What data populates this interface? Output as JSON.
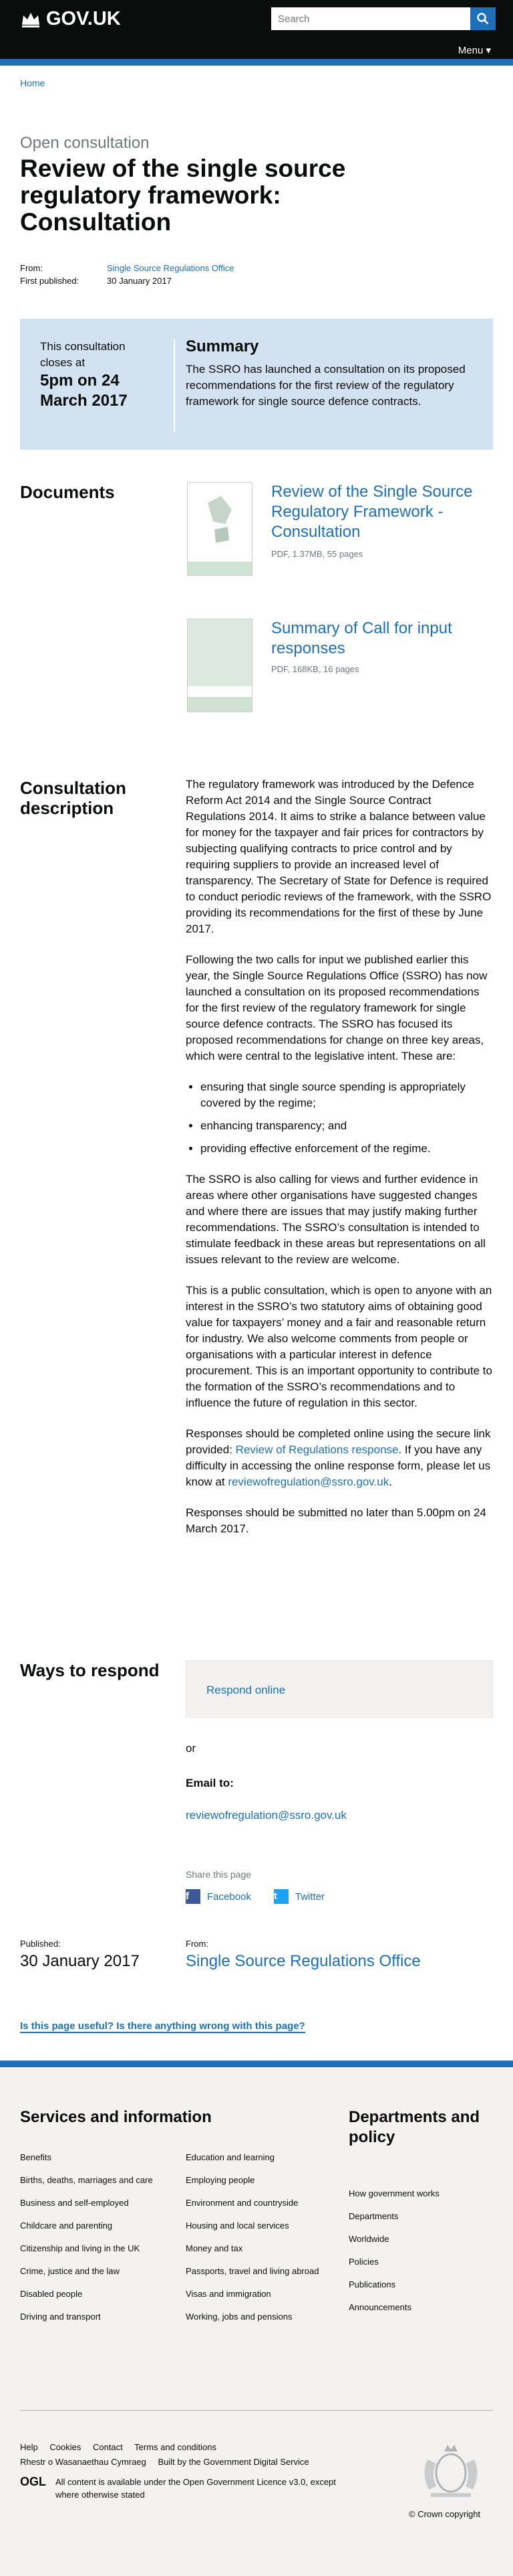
{
  "header": {
    "logo": "GOV.UK",
    "search_placeholder": "Search",
    "menu": "Menu"
  },
  "breadcrumb": {
    "home": "Home"
  },
  "caption": "Open consultation",
  "title": "Review of the single source regulatory framework: Consultation",
  "meta": {
    "from_label": "From:",
    "from_value": "Single Source Regulations Office",
    "published_label": "First published:",
    "published_value": "30 January 2017"
  },
  "callout": {
    "closes_line1": "This consultation closes at",
    "closes_bold": "5pm on 24 March 2017",
    "summary_heading": "Summary",
    "summary_text": "The SSRO has launched a consultation on its proposed recommendations for the first review of the regulatory framework for single source defence contracts."
  },
  "documents": {
    "heading": "Documents",
    "items": [
      {
        "title": "Review of the Single Source Regulatory Framework - Consultation",
        "meta": "PDF, 1.37MB, 55 pages"
      },
      {
        "title": "Summary of Call for input responses",
        "meta": "PDF, 168KB, 16 pages"
      }
    ]
  },
  "description": {
    "heading": "Consultation description",
    "p1": "The regulatory framework was introduced by the Defence Reform Act 2014 and the Single Source Contract Regulations 2014. It aims to strike a balance between value for money for the taxpayer and fair prices for contractors by subjecting qualifying contracts to price control and by requiring suppliers to provide an increased level of transparency. The Secretary of State for Defence is required to conduct periodic reviews of the framework, with the SSRO providing its recommendations for the first of these by June 2017.",
    "p2": "Following the two calls for input we published earlier this year, the Single Source Regulations Office (SSRO) has now launched a consultation on its proposed recommendations for the first review of the regulatory framework for single source defence contracts. The SSRO has focused its proposed recommendations for change on three key areas, which were central to the legislative intent. These are:",
    "bullets": [
      "ensuring that single source spending is appropriately covered by the regime;",
      "enhancing transparency; and",
      "providing effective enforcement of the regime."
    ],
    "p3": "The SSRO is also calling for views and further evidence in areas where other organisations have suggested changes and where there are issues that may justify making further recommendations. The SSRO’s consultation is intended to stimulate feedback in these areas but representations on all issues relevant to the review are welcome.",
    "p4": "This is a public consultation, which is open to anyone with an interest in the SSRO’s two statutory aims of obtaining good value for taxpayers’ money and a fair and reasonable return for industry. We also welcome comments from people or organisations with a particular interest in defence procurement. This is an important opportunity to contribute to the formation of the SSRO’s recommendations and to influence the future of regulation in this sector.",
    "p5_start": "Responses should be completed online using the secure link provided: ",
    "p5_link": "Review of Regulations response",
    "p5_mid": ". If you have any difficulty in accessing the online response form, please let us know at ",
    "p5_email": "reviewofregulation@ssro.gov.uk",
    "p5_end": ".",
    "p6": "Responses should be submitted no later than 5.00pm on 24 March 2017."
  },
  "respond": {
    "heading": "Ways to respond",
    "online": "Respond online",
    "or": "or",
    "email_heading": "Email to:",
    "email": "reviewofregulation@ssro.gov.uk"
  },
  "share": {
    "label": "Share this page",
    "facebook": "Facebook",
    "twitter": "Twitter"
  },
  "published": {
    "label": "Published:",
    "value": "30 January 2017",
    "from_label": "From:",
    "from_value": "Single Source Regulations Office"
  },
  "helpful": "Is this page useful? Is there anything wrong with this page?",
  "footer": {
    "services_heading": "Services and information",
    "col1": [
      "Benefits",
      "Births, deaths, marriages and care",
      "Business and self-employed",
      "Childcare and parenting",
      "Citizenship and living in the UK",
      "Crime, justice and the law",
      "Disabled people",
      "Driving and transport"
    ],
    "col2": [
      "Education and learning",
      "Employing people",
      "Environment and countryside",
      "Housing and local services",
      "Money and tax",
      "Passports, travel and living abroad",
      "Visas and immigration",
      "Working, jobs and pensions"
    ],
    "depts_heading": "Departments and policy",
    "col3": [
      "How government works",
      "Departments",
      "Worldwide",
      "Policies",
      "Publications",
      "Announcements"
    ],
    "bottom_links": [
      "Help",
      "Cookies",
      "Contact",
      "Terms and conditions",
      "Rhestr o Wasanaethau Cymraeg"
    ],
    "built_by": "Built by the ",
    "built_by_link": "Government Digital Service",
    "ogl_mark": "OGL",
    "licence_text": "All content is available under the ",
    "licence_link": "Open Government Licence v3.0",
    "licence_end": ", except where otherwise stated",
    "copyright": "© Crown copyright"
  }
}
